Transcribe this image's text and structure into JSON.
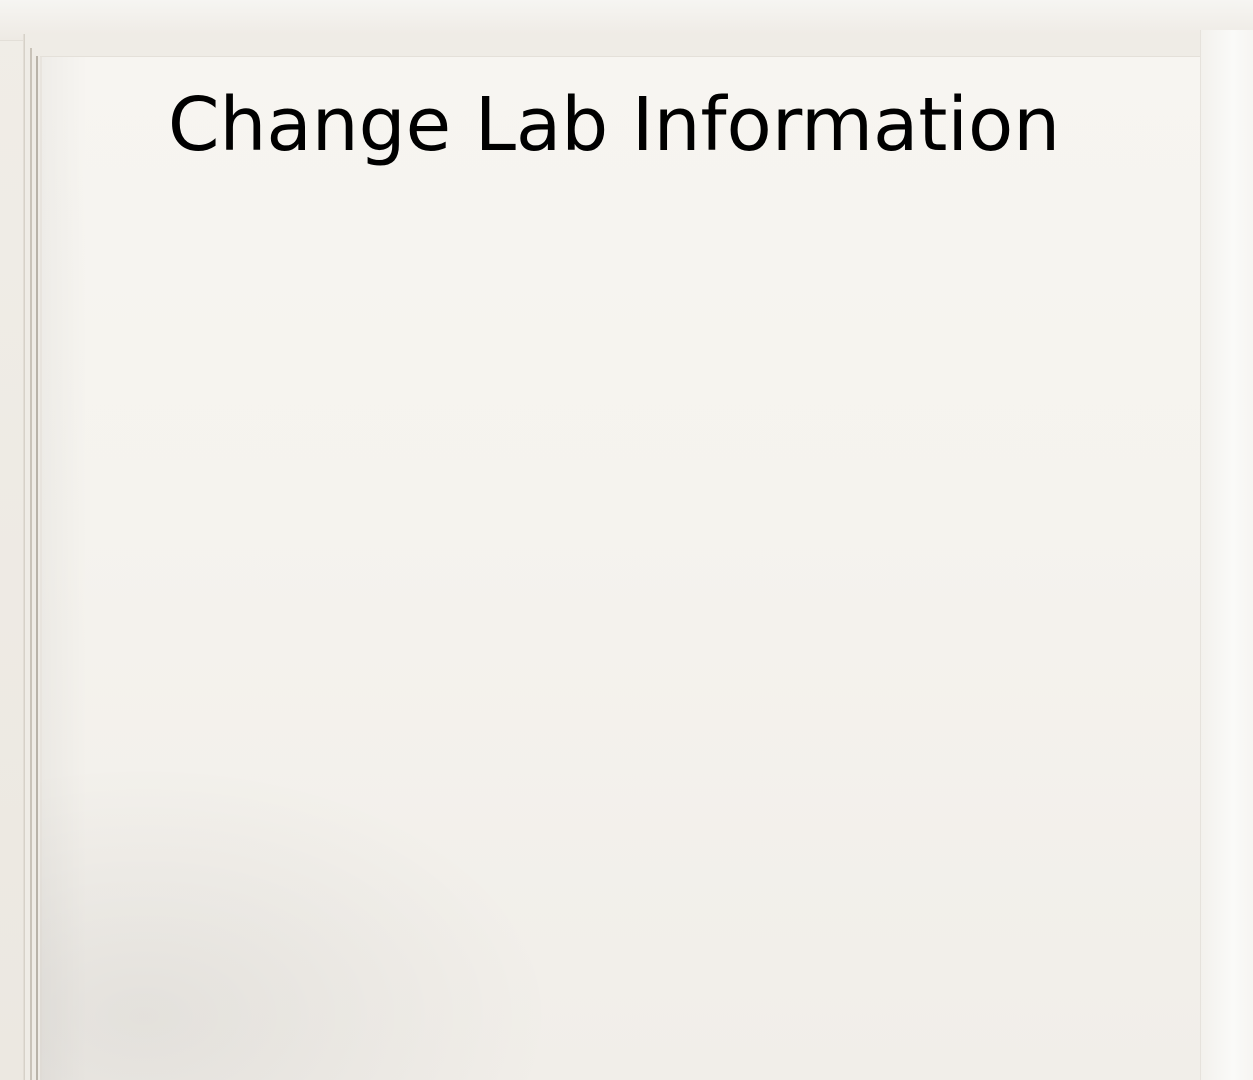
{
  "title": "Change Lab Information",
  "colors": {
    "paper": "#f5f3ee",
    "text": "#000000"
  }
}
